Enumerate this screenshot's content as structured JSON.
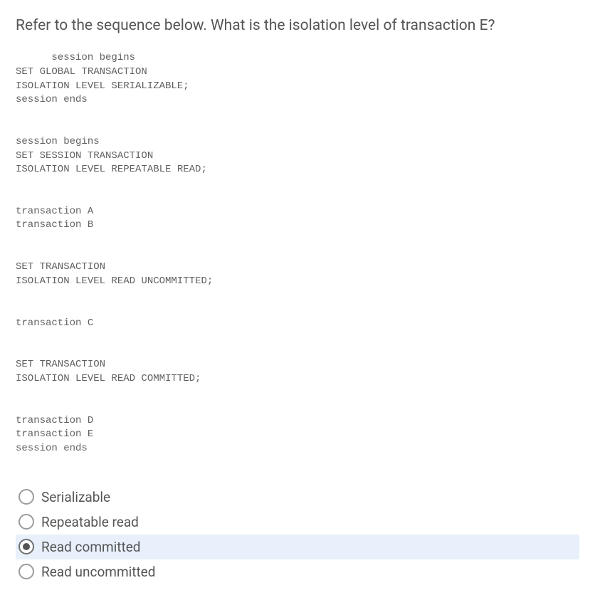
{
  "question": "Refer to the sequence below. What is the isolation level of transaction E?",
  "code": {
    "l1": "      session begins",
    "l2": "SET GLOBAL TRANSACTION",
    "l3": "ISOLATION LEVEL SERIALIZABLE;",
    "l4": "session ends",
    "l5": "",
    "l6": "",
    "l7": "session begins",
    "l8": "SET SESSION TRANSACTION",
    "l9": "ISOLATION LEVEL REPEATABLE READ;",
    "l10": "",
    "l11": "",
    "l12": "transaction A",
    "l13": "transaction B",
    "l14": "",
    "l15": "",
    "l16": "SET TRANSACTION",
    "l17": "ISOLATION LEVEL READ UNCOMMITTED;",
    "l18": "",
    "l19": "",
    "l20": "transaction C",
    "l21": "",
    "l22": "",
    "l23": "SET TRANSACTION",
    "l24": "ISOLATION LEVEL READ COMMITTED;",
    "l25": "",
    "l26": "",
    "l27": "transaction D",
    "l28": "transaction E",
    "l29": "session ends"
  },
  "options": {
    "a": "Serializable",
    "b": "Repeatable read",
    "c": "Read committed",
    "d": "Read uncommitted"
  },
  "selected": "c"
}
